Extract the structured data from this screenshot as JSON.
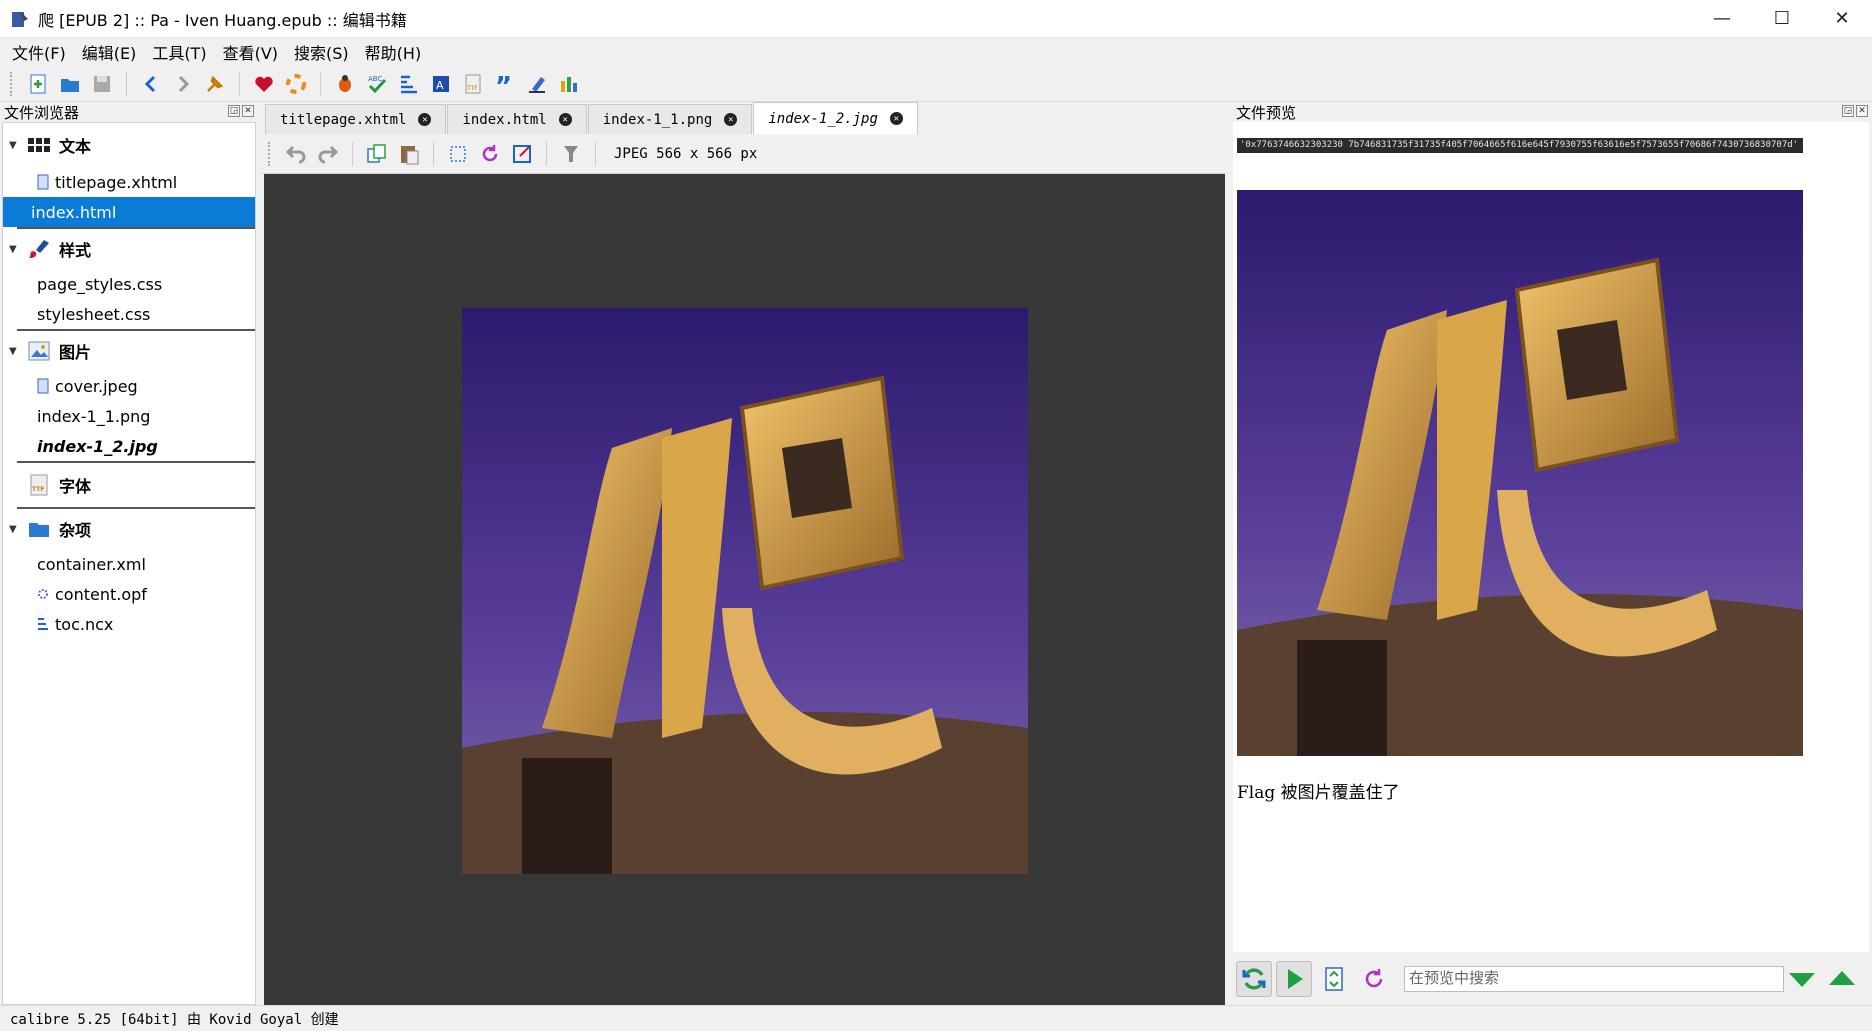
{
  "window": {
    "title": "爬 [EPUB 2] :: Pa - Iven Huang.epub :: 编辑书籍",
    "minimize": "—",
    "maximize": "☐",
    "close": "✕"
  },
  "menubar": [
    "文件(F)",
    "编辑(E)",
    "工具(T)",
    "查看(V)",
    "搜索(S)",
    "帮助(H)"
  ],
  "file_browser": {
    "title": "文件浏览器",
    "categories": [
      {
        "label": "文本",
        "icon": "text-grid-icon",
        "files": [
          {
            "name": "titlepage.xhtml",
            "icon": "document-icon"
          },
          {
            "name": "index.html",
            "icon": "",
            "selected": true
          }
        ]
      },
      {
        "label": "样式",
        "icon": "brush-icon",
        "files": [
          {
            "name": "page_styles.css",
            "icon": ""
          },
          {
            "name": "stylesheet.css",
            "icon": ""
          }
        ]
      },
      {
        "label": "图片",
        "icon": "image-icon",
        "files": [
          {
            "name": "cover.jpeg",
            "icon": "document-icon"
          },
          {
            "name": "index-1_1.png",
            "icon": ""
          },
          {
            "name": "index-1_2.jpg",
            "icon": "",
            "current": true
          }
        ]
      },
      {
        "label": "字体",
        "icon": "font-icon",
        "files": []
      },
      {
        "label": "杂项",
        "icon": "folder-icon",
        "files": [
          {
            "name": "container.xml",
            "icon": ""
          },
          {
            "name": "content.opf",
            "icon": "gear-icon"
          },
          {
            "name": "toc.ncx",
            "icon": "toc-icon"
          }
        ]
      }
    ]
  },
  "editor": {
    "tabs": [
      {
        "label": "titlepage.xhtml",
        "active": false
      },
      {
        "label": "index.html",
        "active": false
      },
      {
        "label": "index-1_1.png",
        "active": false
      },
      {
        "label": "index-1_2.jpg",
        "active": true
      }
    ],
    "image_info": "JPEG  566 x 566 px",
    "image_char": "爬"
  },
  "preview": {
    "title": "文件预览",
    "flag_hex": "'0x7763746632303230 7b746831735f31735f405f7064665f616e645f7930755f63616e5f7573655f70686f7430736830707d'",
    "caption": "Flag 被图片覆盖住了",
    "search_placeholder": "在预览中搜索"
  },
  "statusbar": "calibre 5.25 [64bit] 由 Kovid Goyal 创建",
  "colors": {
    "selection": "#0a7bd6",
    "canvas": "#383838",
    "image_sky": "#3b2a7a",
    "image_gold": "#d9a64a"
  }
}
